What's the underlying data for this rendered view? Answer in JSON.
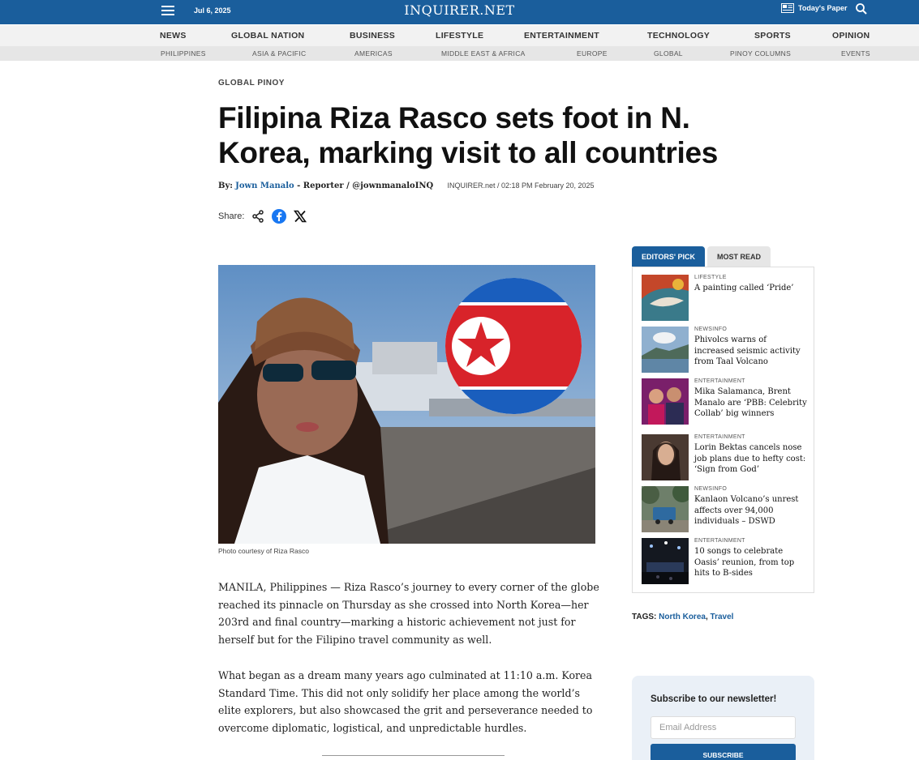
{
  "topbar": {
    "date": "Jul 6, 2025",
    "logo": "INQUIRER.NET",
    "todays_paper": "Today's Paper"
  },
  "nav": {
    "items": [
      "NEWS",
      "GLOBAL NATION",
      "BUSINESS",
      "LIFESTYLE",
      "ENTERTAINMENT",
      "TECHNOLOGY",
      "SPORTS",
      "OPINION"
    ],
    "subitems": [
      "PHILIPPINES",
      "ASIA & PACIFIC",
      "AMERICAS",
      "MIDDLE EAST & AFRICA",
      "EUROPE",
      "GLOBAL",
      "PINOY COLUMNS",
      "EVENTS"
    ]
  },
  "article": {
    "kicker": "GLOBAL PINOY",
    "headline": "Filipina Riza Rasco sets foot in N. Korea, marking visit to all countries",
    "by_label": "By:",
    "author": "Jown Manalo",
    "role": " - Reporter / ",
    "handle": "@jownmanaloINQ",
    "source_time": "INQUIRER.net / 02:18 PM February 20, 2025",
    "share_label": "Share:",
    "caption": "Photo courtesy of Riza Rasco",
    "paragraphs": [
      "MANILA, Philippines — Riza Rasco’s journey to every corner of the globe reached its pinnacle on Thursday as she crossed into North Korea—her 203rd and final country—marking a historic achievement not just for herself but for the Filipino travel community as well.",
      "What began as a dream many years ago culminated at 11:10 a.m. Korea Standard Time. This did not only solidify her place among the world’s elite explorers, but also showcased the grit and perseverance needed to overcome diplomatic, logistical, and unpredictable hurdles."
    ]
  },
  "sidebar": {
    "tabs": [
      "EDITORS' PICK",
      "MOST READ"
    ],
    "picks": [
      {
        "category": "LIFESTYLE",
        "title": "A painting called ‘Pride’"
      },
      {
        "category": "NEWSINFO",
        "title": "Phivolcs warns of increased seismic activity from Taal Volcano"
      },
      {
        "category": "ENTERTAINMENT",
        "title": "Mika Salamanca, Brent Manalo are ‘PBB: Celebrity Collab’ big winners"
      },
      {
        "category": "ENTERTAINMENT",
        "title": "Lorin Bektas cancels nose job plans due to hefty cost: ‘Sign from God’"
      },
      {
        "category": "NEWSINFO",
        "title": "Kanlaon Volcano’s unrest affects over 94,000 individuals – DSWD"
      },
      {
        "category": "ENTERTAINMENT",
        "title": "10 songs to celebrate Oasis’ reunion, from top hits to B-sides"
      }
    ],
    "tags_label": "TAGS:",
    "tags": [
      "North Korea",
      "Travel"
    ],
    "newsletter": {
      "title": "Subscribe to our newsletter!",
      "placeholder": "Email Address",
      "button": "SUBSCRIBE"
    }
  }
}
